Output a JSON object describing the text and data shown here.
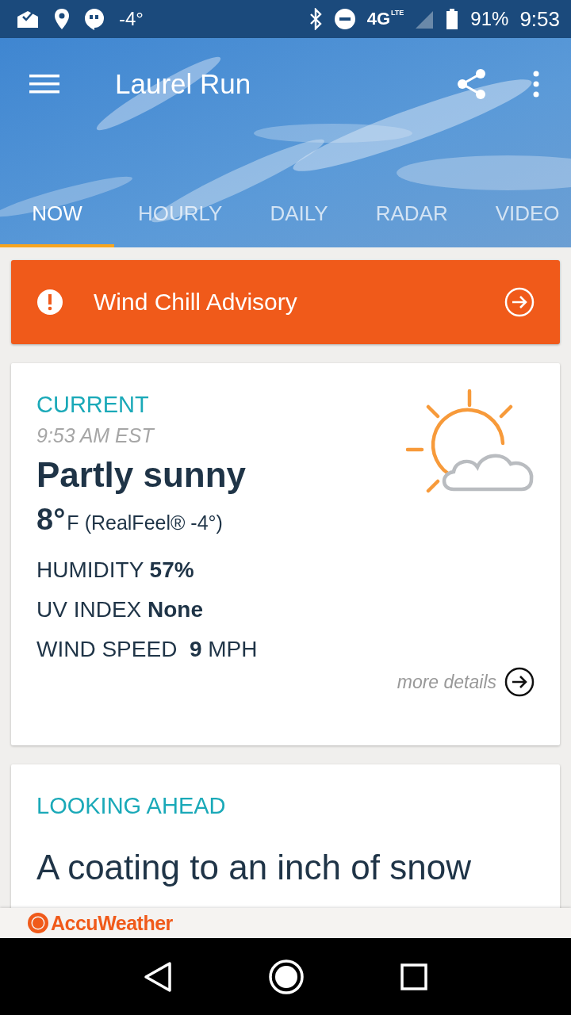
{
  "status_bar": {
    "temperature": "-4°",
    "network": "4G",
    "network_sub": "LTE",
    "battery": "91%",
    "time": "9:53"
  },
  "toolbar": {
    "title": "Laurel Run"
  },
  "tabs": [
    {
      "label": "NOW",
      "selected": true
    },
    {
      "label": "HOURLY",
      "selected": false
    },
    {
      "label": "DAILY",
      "selected": false
    },
    {
      "label": "RADAR",
      "selected": false
    },
    {
      "label": "VIDEO",
      "selected": false
    }
  ],
  "alert": {
    "text": "Wind Chill Advisory"
  },
  "current": {
    "heading": "CURRENT",
    "time": "9:53 AM EST",
    "condition": "Partly sunny",
    "temperature": "8°",
    "unit": "F",
    "realfeel": "(RealFeel® -4°)",
    "details": [
      "HUMIDITY **57%**",
      "UV INDEX **None**",
      "WIND SPEED  **9** MPH"
    ],
    "more": "more details"
  },
  "looking_ahead": {
    "heading": "LOOKING AHEAD",
    "text": "A coating to an inch of snow"
  },
  "footer": {
    "brand": "AccuWeather"
  }
}
